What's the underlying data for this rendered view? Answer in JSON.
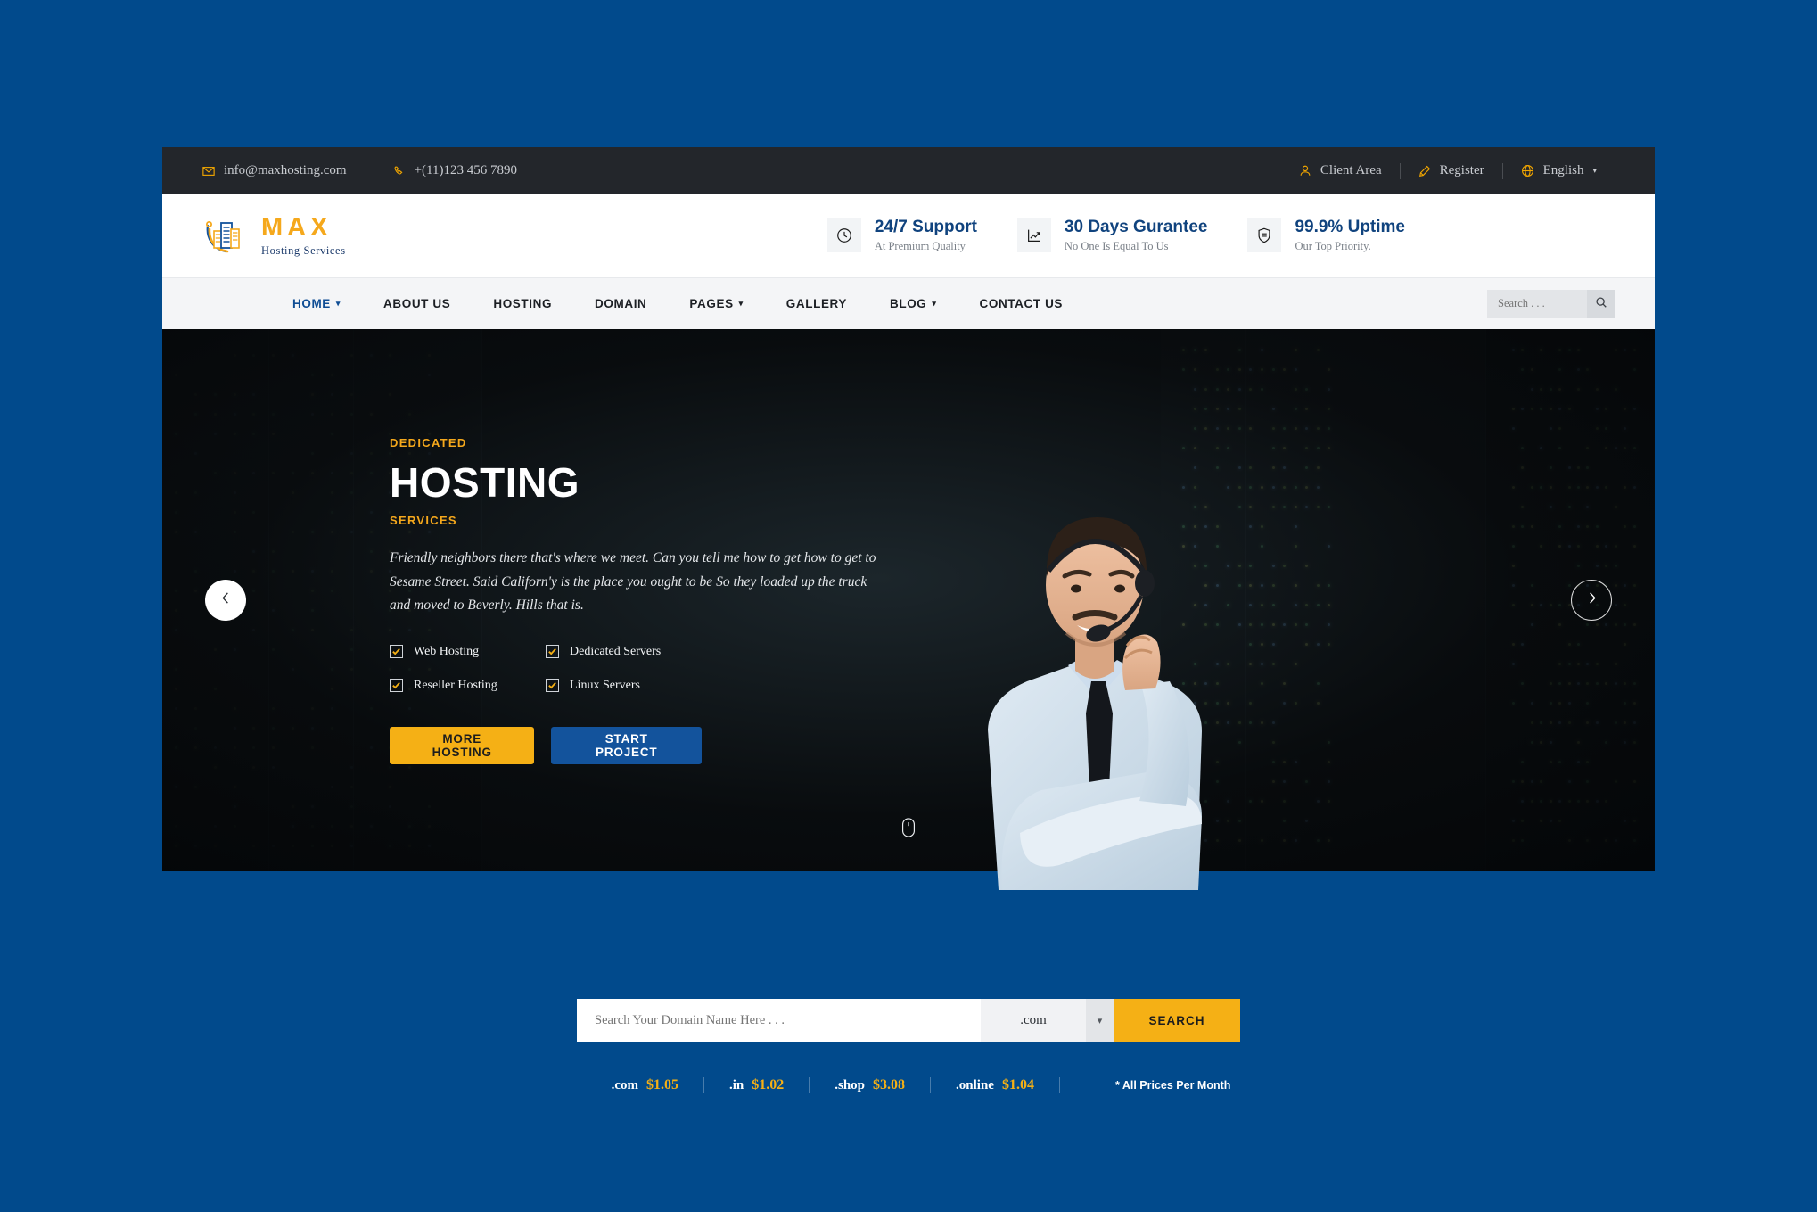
{
  "theme": {
    "page_bg": "#014A8C",
    "accent_amber": "#F5B015",
    "accent_blue": "#13539C",
    "topbar_bg": "#23262B",
    "nav_bg": "#F4F5F7"
  },
  "topbar": {
    "email": "info@maxhosting.com",
    "phone": "+(11)123 456 7890",
    "client_area": "Client Area",
    "register": "Register",
    "language": "English"
  },
  "logo": {
    "name": "MAX",
    "tagline": "Hosting Services"
  },
  "features": [
    {
      "icon": "clock-icon",
      "title": "24/7 Support",
      "subtitle": "At Premium Quality"
    },
    {
      "icon": "chart-growth-icon",
      "title": "30 Days Gurantee",
      "subtitle": "No One Is Equal To Us"
    },
    {
      "icon": "shield-icon",
      "title": "99.9% Uptime",
      "subtitle": "Our Top Priority."
    }
  ],
  "nav": {
    "items": [
      {
        "label": "HOME",
        "has_dropdown": true,
        "active": true
      },
      {
        "label": "ABOUT US",
        "has_dropdown": false,
        "active": false
      },
      {
        "label": "HOSTING",
        "has_dropdown": false,
        "active": false
      },
      {
        "label": "DOMAIN",
        "has_dropdown": false,
        "active": false
      },
      {
        "label": "PAGES",
        "has_dropdown": true,
        "active": false
      },
      {
        "label": "GALLERY",
        "has_dropdown": false,
        "active": false
      },
      {
        "label": "BLOG",
        "has_dropdown": true,
        "active": false
      },
      {
        "label": "CONTACT US",
        "has_dropdown": false,
        "active": false
      }
    ],
    "search_placeholder": "Search . . ."
  },
  "hero": {
    "kicker": "DEDICATED",
    "title": "HOSTING",
    "kicker2": "SERVICES",
    "paragraph": "Friendly neighbors there that's where we meet. Can you tell me how to get how to get to Sesame Street. Said Californ'y is the place you ought to be So they loaded up the truck and moved to Beverly. Hills that is.",
    "checklist": [
      "Web Hosting",
      "Dedicated Servers",
      "Reseller Hosting",
      "Linux Servers"
    ],
    "btn_primary": "MORE HOSTING",
    "btn_secondary": "START PROJECT"
  },
  "domain": {
    "placeholder": "Search Your Domain Name Here . . .",
    "tld_selected": ".com",
    "search_label": "SEARCH",
    "prices": [
      {
        "tld": ".com",
        "price": "$1.05"
      },
      {
        "tld": ".in",
        "price": "$1.02"
      },
      {
        "tld": ".shop",
        "price": "$3.08"
      },
      {
        "tld": ".online",
        "price": "$1.04"
      }
    ],
    "note": "* All Prices Per Month"
  }
}
